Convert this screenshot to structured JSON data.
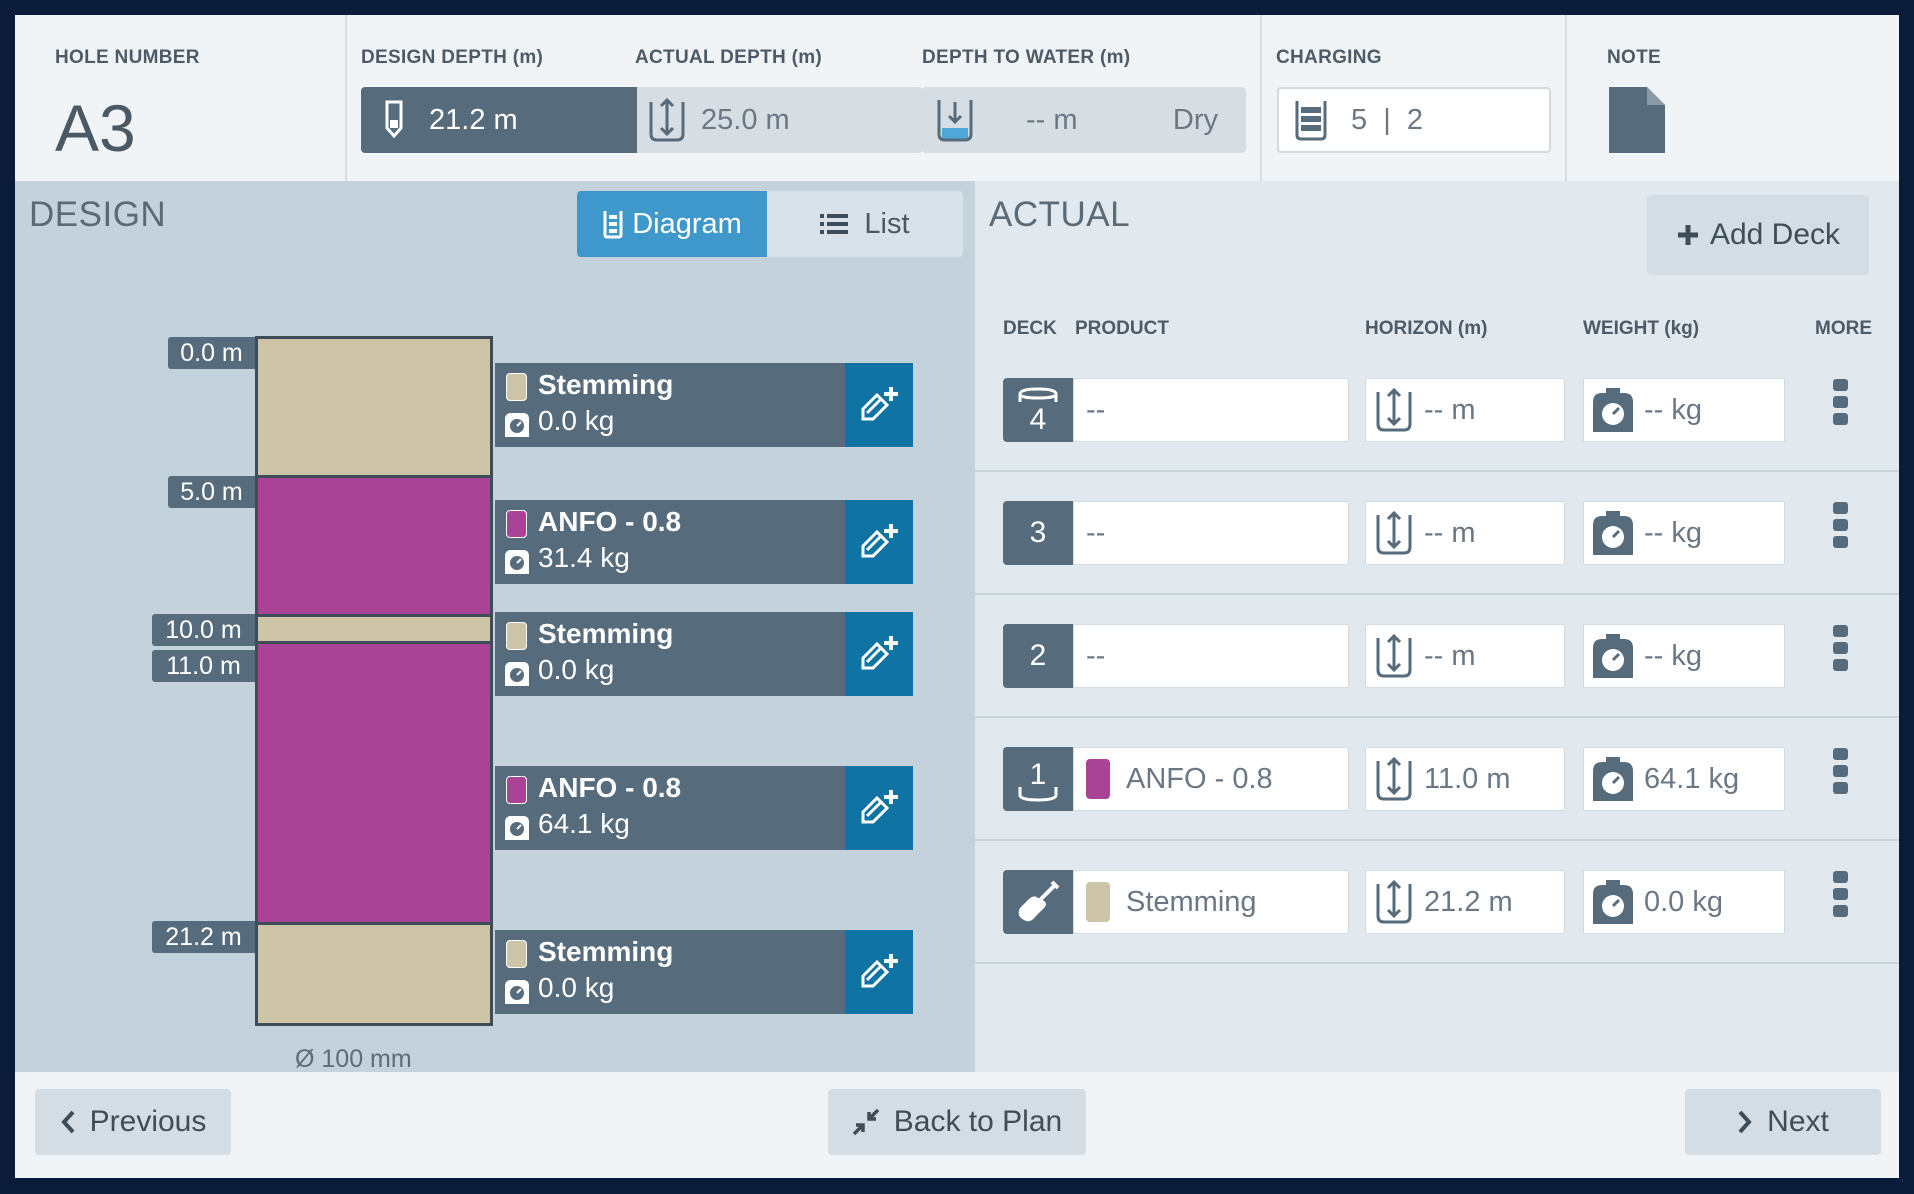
{
  "header": {
    "hole_number_label": "HOLE NUMBER",
    "hole_number": "A3",
    "design_depth_label": "DESIGN DEPTH (m)",
    "design_depth": "21.2 m",
    "actual_depth_label": "ACTUAL DEPTH (m)",
    "actual_depth": "25.0 m",
    "depth_to_water_label": "DEPTH TO WATER (m)",
    "depth_to_water": "-- m",
    "water_state": "Dry",
    "charging_label": "CHARGING",
    "charging_value": "5  |  2",
    "note_label": "NOTE"
  },
  "design": {
    "title": "DESIGN",
    "view_diagram": "Diagram",
    "view_list": "List",
    "diameter": "Ø 100 mm",
    "depth_labels": [
      "0.0 m",
      "5.0 m",
      "10.0 m",
      "11.0 m",
      "21.2 m"
    ],
    "decks": [
      {
        "name": "Stemming",
        "weight": "0.0 kg"
      },
      {
        "name": "ANFO - 0.8",
        "weight": "31.4 kg"
      },
      {
        "name": "Stemming",
        "weight": "0.0 kg"
      },
      {
        "name": "ANFO - 0.8",
        "weight": "64.1 kg"
      },
      {
        "name": "Stemming",
        "weight": "0.0 kg"
      }
    ]
  },
  "actual": {
    "title": "ACTUAL",
    "add_deck": "Add Deck",
    "columns": {
      "deck": "DECK",
      "product": "PRODUCT",
      "horizon": "HORIZON (m)",
      "weight": "WEIGHT (kg)",
      "more": "MORE"
    },
    "rows": [
      {
        "deck": "4",
        "product": "--",
        "horizon": "-- m",
        "weight": "-- kg"
      },
      {
        "deck": "3",
        "product": "--",
        "horizon": "-- m",
        "weight": "-- kg"
      },
      {
        "deck": "2",
        "product": "--",
        "horizon": "-- m",
        "weight": "-- kg"
      },
      {
        "deck": "1",
        "product": "ANFO - 0.8",
        "horizon": "11.0 m",
        "weight": "64.1 kg"
      },
      {
        "deck": "",
        "product": "Stemming",
        "horizon": "21.2 m",
        "weight": "0.0 kg"
      }
    ]
  },
  "footer": {
    "previous": "Previous",
    "back_to_plan": "Back to Plan",
    "next": "Next"
  },
  "colors": {
    "stemming": "#cdc4a8",
    "anfo": "#a84396",
    "accent": "#3f98cb",
    "edit": "#0f73a3",
    "dark": "#566b7b"
  }
}
